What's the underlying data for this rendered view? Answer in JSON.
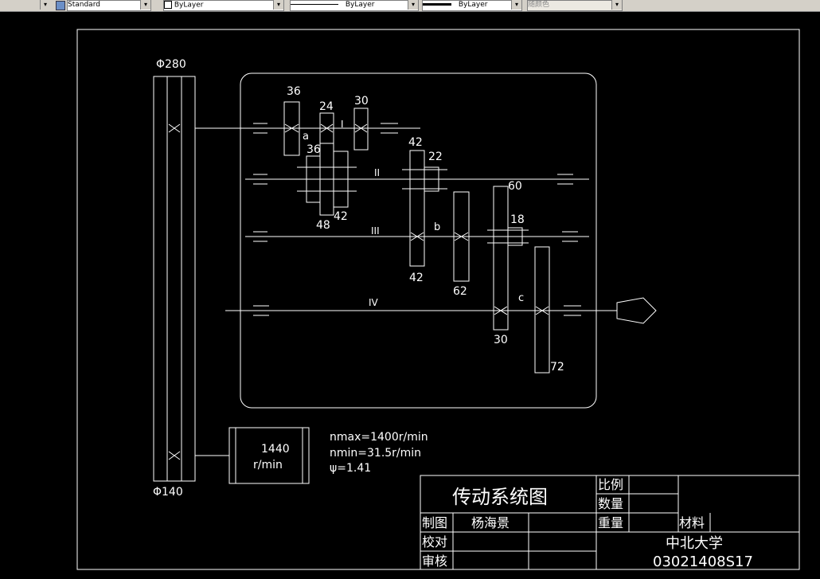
{
  "toolbar": {
    "style_value": "Standard",
    "layer_value": "ByLayer",
    "linetype_value": "ByLayer",
    "lineweight_value": "ByLayer",
    "color_value": "随颜色"
  },
  "drawing": {
    "pulley_top_label": "Φ280",
    "pulley_bottom_label": "Φ140",
    "motor_speed": "1440",
    "motor_unit": "r/min",
    "nmax_text": "nmax=1400r/min",
    "nmin_text": "nmin=31.5r/min",
    "phi_text": "ψ=1.41",
    "gears": {
      "g36_top": "36",
      "g24": "24",
      "g30_top": "30",
      "g36_mid": "36",
      "g48": "48",
      "g42_mid": "42",
      "g42_top": "42",
      "g22": "22",
      "g60": "60",
      "g18": "18",
      "g42_bottom": "42",
      "g62": "62",
      "g30_bottom": "30",
      "g72": "72"
    },
    "shafts": {
      "s1": "I",
      "s2": "II",
      "s3": "III",
      "s4": "IV"
    },
    "groups": {
      "a": "a",
      "b": "b",
      "c": "c"
    }
  },
  "title_block": {
    "title": "传动系统图",
    "scale_label": "比例",
    "quantity_label": "数量",
    "weight_label": "重量",
    "material_label": "材料",
    "drawn_label": "制图",
    "drawn_by": "杨海景",
    "checked_label": "校对",
    "approved_label": "审核",
    "school": "中北大学",
    "student_id": "03021408S17"
  }
}
